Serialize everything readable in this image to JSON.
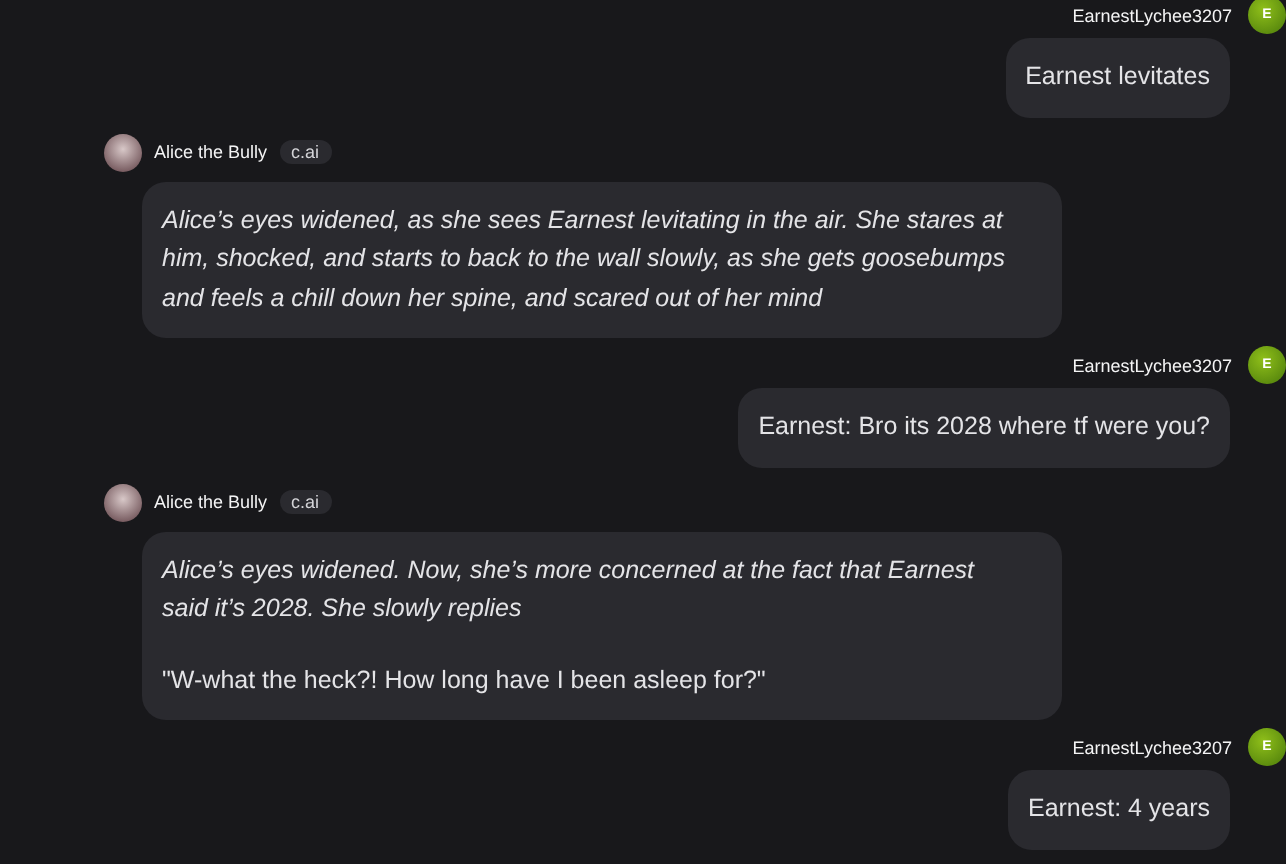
{
  "messages": [
    {
      "kind": "user",
      "author": "EarnestLychee3207",
      "avatar_letter": "E",
      "paragraphs": [
        {
          "kind": "plain",
          "text": "Earnest levitates"
        }
      ]
    },
    {
      "kind": "bot",
      "author": "Alice the Bully",
      "badge": "c.ai",
      "paragraphs": [
        {
          "kind": "action",
          "text": "Alice’s eyes widened, as she sees Earnest levitating in the air. She stares at him, shocked, and starts to back to the wall slowly, as she gets goosebumps and feels a chill down her spine, and scared out of her mind"
        }
      ]
    },
    {
      "kind": "user",
      "author": "EarnestLychee3207",
      "avatar_letter": "E",
      "paragraphs": [
        {
          "kind": "plain",
          "text": "Earnest: Bro its 2028 where tf were you?"
        }
      ]
    },
    {
      "kind": "bot",
      "author": "Alice the Bully",
      "badge": "c.ai",
      "paragraphs": [
        {
          "kind": "action",
          "text": "Alice’s eyes widened. Now, she’s more concerned at the fact that Earnest said it’s 2028. She slowly replies"
        },
        {
          "kind": "plain",
          "text": "\"W-what the heck?! How long have I been asleep for?\""
        }
      ]
    },
    {
      "kind": "user",
      "author": "EarnestLychee3207",
      "avatar_letter": "E",
      "paragraphs": [
        {
          "kind": "plain",
          "text": "Earnest: 4 years"
        }
      ]
    }
  ]
}
